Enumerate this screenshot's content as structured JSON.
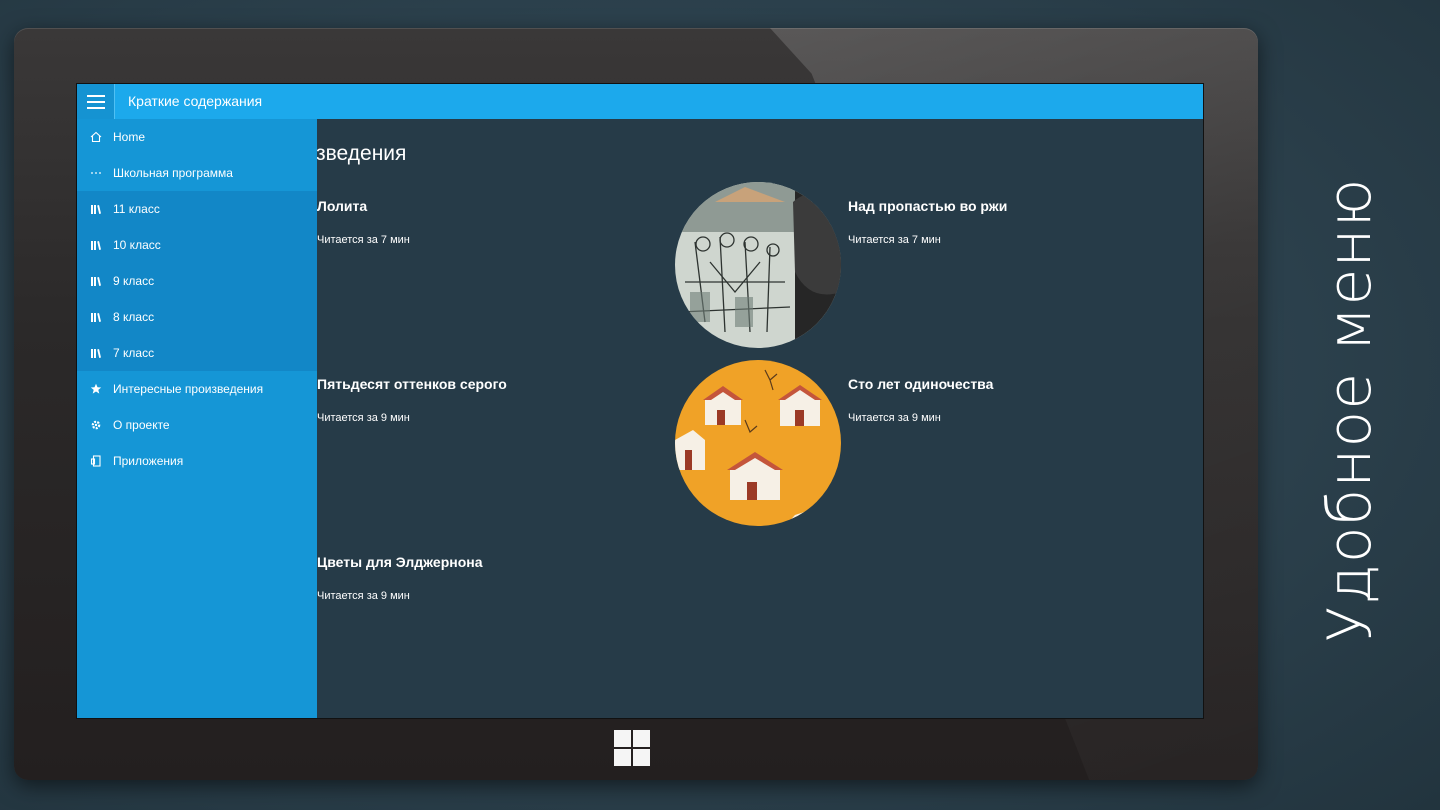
{
  "app": {
    "title": "Краткие содержания"
  },
  "sidebar": {
    "items": [
      {
        "label": "Home",
        "icon": "home-icon"
      },
      {
        "label": "Школьная программа",
        "icon": "more-icon"
      },
      {
        "label": "11 класс",
        "icon": "books-icon"
      },
      {
        "label": "10 класс",
        "icon": "books-icon"
      },
      {
        "label": "9 класс",
        "icon": "books-icon"
      },
      {
        "label": "8 класс",
        "icon": "books-icon"
      },
      {
        "label": "7 класс",
        "icon": "books-icon"
      },
      {
        "label": "Интересные произведения",
        "icon": "star-icon"
      },
      {
        "label": "О проекте",
        "icon": "settings-icon"
      },
      {
        "label": "Приложения",
        "icon": "apps-icon"
      }
    ]
  },
  "content": {
    "section_title": "зведения",
    "books": [
      {
        "title": "Лолита",
        "meta": "Читается за 7 мин"
      },
      {
        "title": "Над пропастью во ржи",
        "meta": "Читается за 7 мин"
      },
      {
        "title": "Пятьдесят оттенков серого",
        "meta": "Читается за 9 мин"
      },
      {
        "title": "Сто лет одиночества",
        "meta": "Читается за 9 мин"
      },
      {
        "title": "Цветы для Элджернона",
        "meta": "Читается за 9 мин"
      }
    ]
  },
  "caption": "Удобное меню",
  "colors": {
    "titlebar": "#1ca9ec",
    "sidebar": "#1596d6",
    "sidebar_sub": "#1287c7",
    "content_bg": "#263b48"
  }
}
